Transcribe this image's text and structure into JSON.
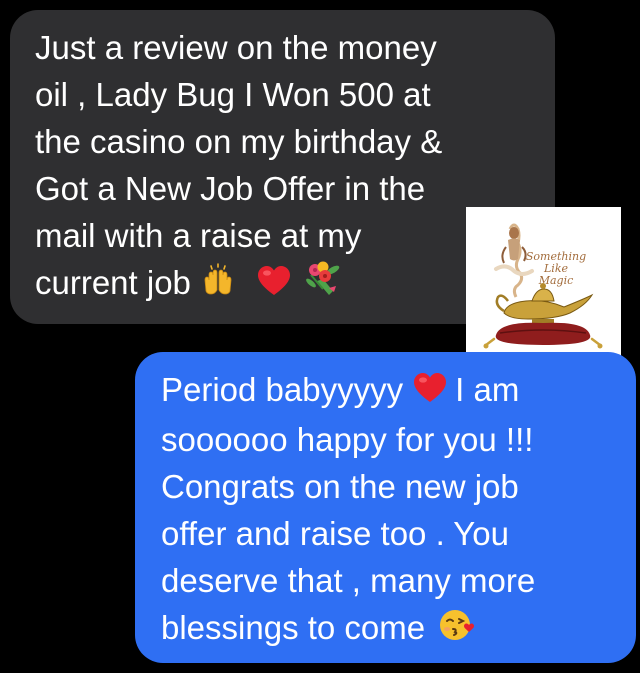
{
  "messages": {
    "received": {
      "lines": [
        "Just a review on the money",
        "oil ,  Lady Bug I Won 500 at",
        "the casino on my birthday &",
        "Got a New Job Offer in the",
        "mail with a raise at my",
        "current job"
      ],
      "emojis": [
        "raising-hands",
        "red-heart",
        "bouquet"
      ]
    },
    "sent": {
      "lines": [
        "Period babyyyyy",
        "I am",
        "soooooo happy for you !!!",
        "Congrats on the new job",
        "offer and raise too . You",
        "deserve that , many more",
        "blessings to come"
      ],
      "emojis": [
        "red-heart",
        "kissing-face-heart"
      ]
    }
  },
  "logo": {
    "text_line1": "Something Like",
    "text_line2": "Magic",
    "icon": "magic-lamp-icon"
  },
  "colors": {
    "background": "#000000",
    "received_bubble": "#2f2f31",
    "sent_bubble": "#2f6ff3",
    "text": "#ffffff"
  }
}
